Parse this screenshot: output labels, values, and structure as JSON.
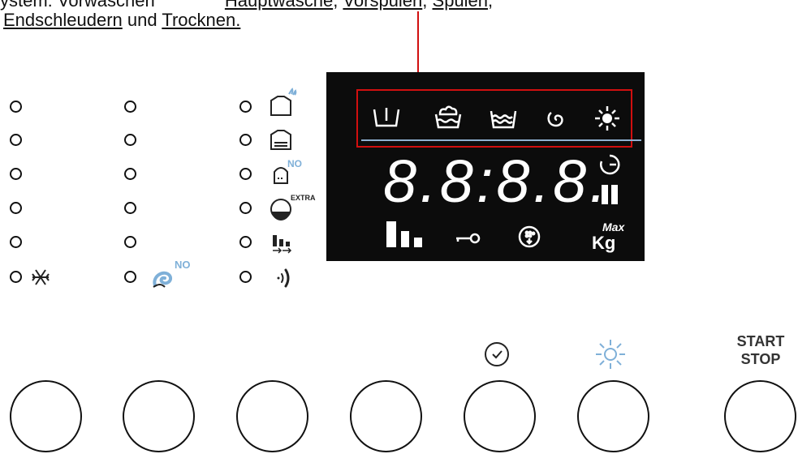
{
  "caption": {
    "line1_lead": "ystem: Vorwaschen  ",
    "line1_items": [
      "Hauptwäsche",
      "Vorspülen",
      "Spülen"
    ],
    "line2_item1": "Endschleudern",
    "line2_joiner": " und ",
    "line2_item2": "Trocknen."
  },
  "display": {
    "digits": "8.8:8.8.",
    "kg_label": "Kg",
    "max_label": "Max",
    "phase_icons": [
      "prewash-icon",
      "mainwash-icon",
      "rinse-icon",
      "spin-icon",
      "dry-icon"
    ],
    "status_icons": [
      "load-level-icon",
      "door-lock-key-icon",
      "water-drop-icon",
      "max-load-icon"
    ],
    "timer_icon": "time-remaining-icon",
    "pause_icon": "pause-icon"
  },
  "option_icons": [
    "cold-wash-icon",
    "no-spin-icon",
    "extra-dry-icon",
    "iron-dry-icon",
    "extra-rinse-icon",
    "spin-speed-icon",
    "sound-icon"
  ],
  "option_labels": {
    "no_label_1": "NO",
    "no_label_2": "NO",
    "extra_label": "EXTRA"
  },
  "buttons": {
    "start_stop_line1": "START",
    "start_stop_line2": "STOP",
    "delay_icon": "delay-start-icon",
    "drying_icon": "drying-icon"
  },
  "colors": {
    "accent_red": "#d10f0f",
    "icon_blue": "#7fb0d8",
    "lcd_background": "#0c0c0c"
  }
}
